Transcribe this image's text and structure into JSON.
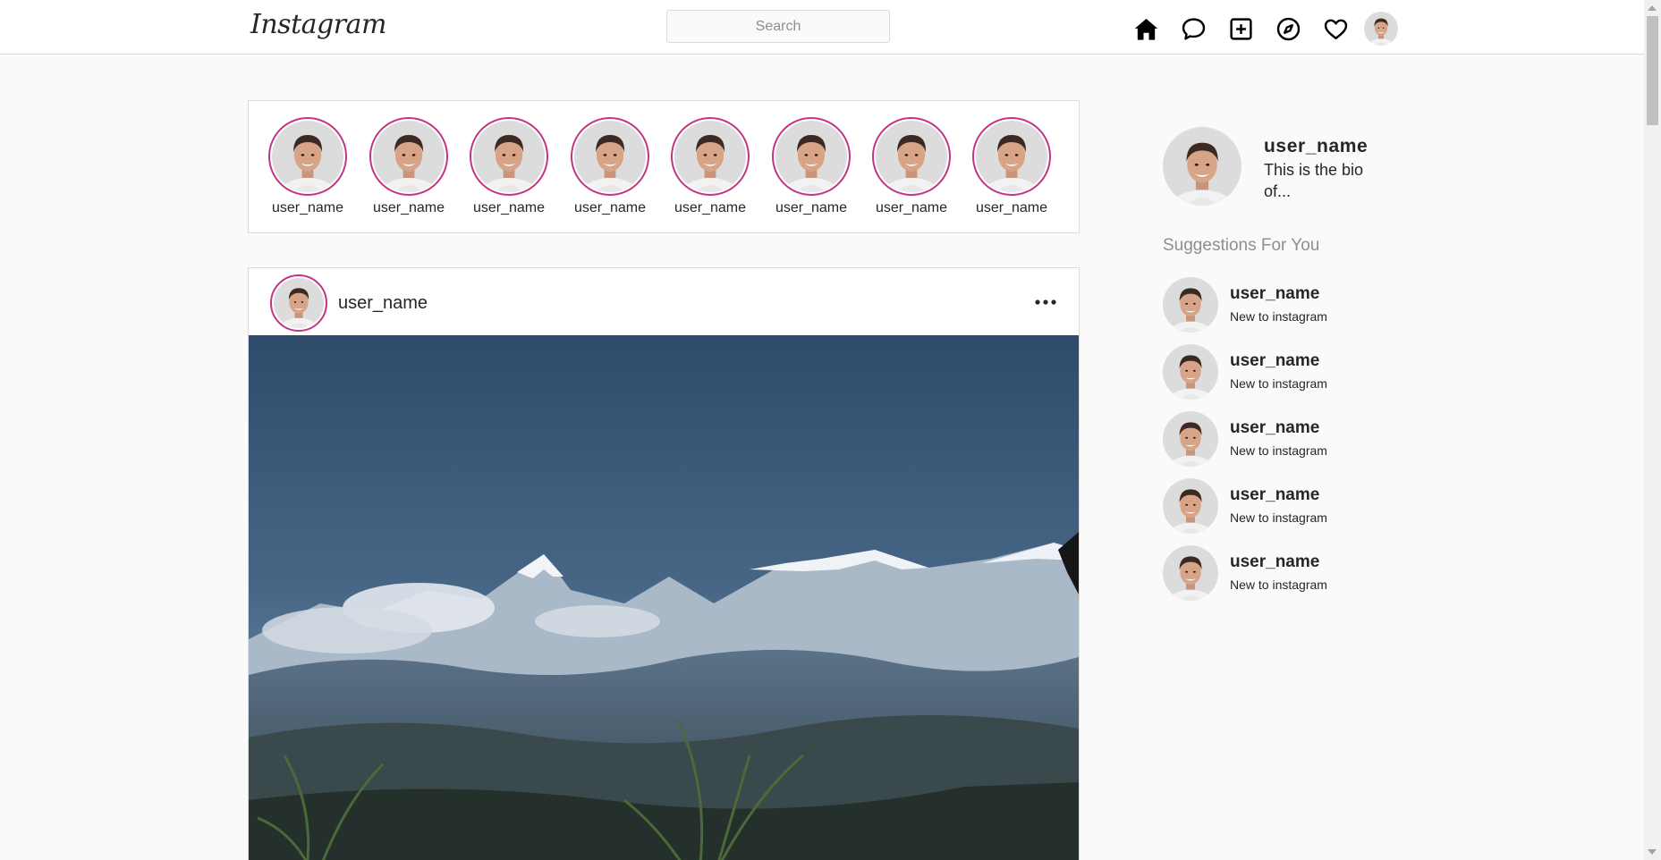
{
  "nav": {
    "logo_text": "Instagram",
    "search_placeholder": "Search",
    "icons": [
      "home-icon",
      "messages-icon",
      "create-post-icon",
      "explore-icon",
      "activity-heart-icon",
      "profile-avatar"
    ]
  },
  "stories": [
    {
      "username": "user_name"
    },
    {
      "username": "user_name"
    },
    {
      "username": "user_name"
    },
    {
      "username": "user_name"
    },
    {
      "username": "user_name"
    },
    {
      "username": "user_name"
    },
    {
      "username": "user_name"
    },
    {
      "username": "user_name"
    }
  ],
  "post": {
    "username": "user_name",
    "more_icon": "more-options-icon",
    "image": "mountain-landscape"
  },
  "sidebar": {
    "profile": {
      "username": "user_name",
      "bio": "This is the bio of..."
    },
    "suggestions_title": "Suggestions For You",
    "suggestions": [
      {
        "username": "user_name",
        "subtitle": "New to instagram"
      },
      {
        "username": "user_name",
        "subtitle": "New to instagram"
      },
      {
        "username": "user_name",
        "subtitle": "New to instagram"
      },
      {
        "username": "user_name",
        "subtitle": "New to instagram"
      },
      {
        "username": "user_name",
        "subtitle": "New to instagram"
      }
    ]
  },
  "colors": {
    "story_ring": "#c13584",
    "border": "#dbdbdb",
    "background": "#fafafa",
    "secondary_text": "#8e8e8e"
  }
}
